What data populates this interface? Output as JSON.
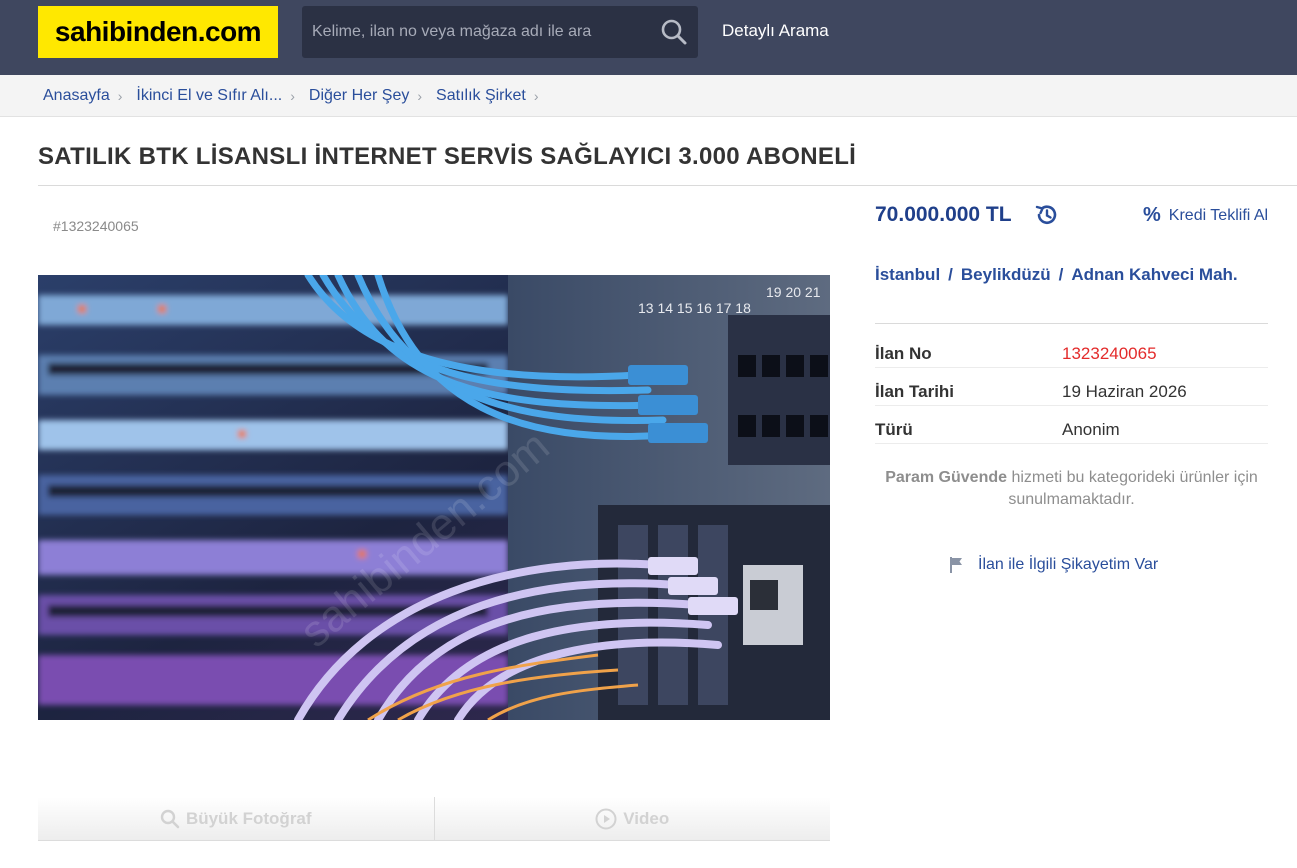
{
  "header": {
    "logo_text": "sahibinden.com",
    "search_placeholder": "Kelime, ilan no veya mağaza adı ile ara",
    "detailed_search": "Detaylı Arama"
  },
  "breadcrumb": [
    {
      "label": "Anasayfa"
    },
    {
      "label": "İkinci El ve Sıfır Alı..."
    },
    {
      "label": "Diğer Her Şey"
    },
    {
      "label": "Satılık Şirket"
    }
  ],
  "listing": {
    "title": "SATILIK BTK LİSANSLI İNTERNET SERVİS SAĞLAYICI 3.000 ABONELİ",
    "id_tag": "#1323240065",
    "price": "70.000.000 TL",
    "credit_offer": "Kredi Teklifi Al",
    "location": {
      "city": "İstanbul",
      "district": "Beylikdüzü",
      "neighborhood": "Adnan Kahveci Mah.",
      "separator": "/"
    },
    "info": [
      {
        "key": "İlan No",
        "value": "1323240065",
        "highlight": true
      },
      {
        "key": "İlan Tarihi",
        "value": "19 Haziran 2026",
        "highlight": false
      },
      {
        "key": "Türü",
        "value": "Anonim",
        "highlight": false
      }
    ],
    "param_guvende_bold": "Param Güvende",
    "param_guvende_rest": " hizmeti bu kategorideki ürünler için sunulmamaktadır.",
    "complaint": "İlan ile İlgili Şikayetim Var",
    "photo_tabs": {
      "large_photo": "Büyük Fotoğraf",
      "video": "Video"
    }
  },
  "colors": {
    "header_bg": "#3f475f",
    "logo_bg": "#ffe800",
    "link_blue": "#2a4e9b",
    "price_blue": "#1f3f8a",
    "highlight_red": "#e32b2b"
  }
}
